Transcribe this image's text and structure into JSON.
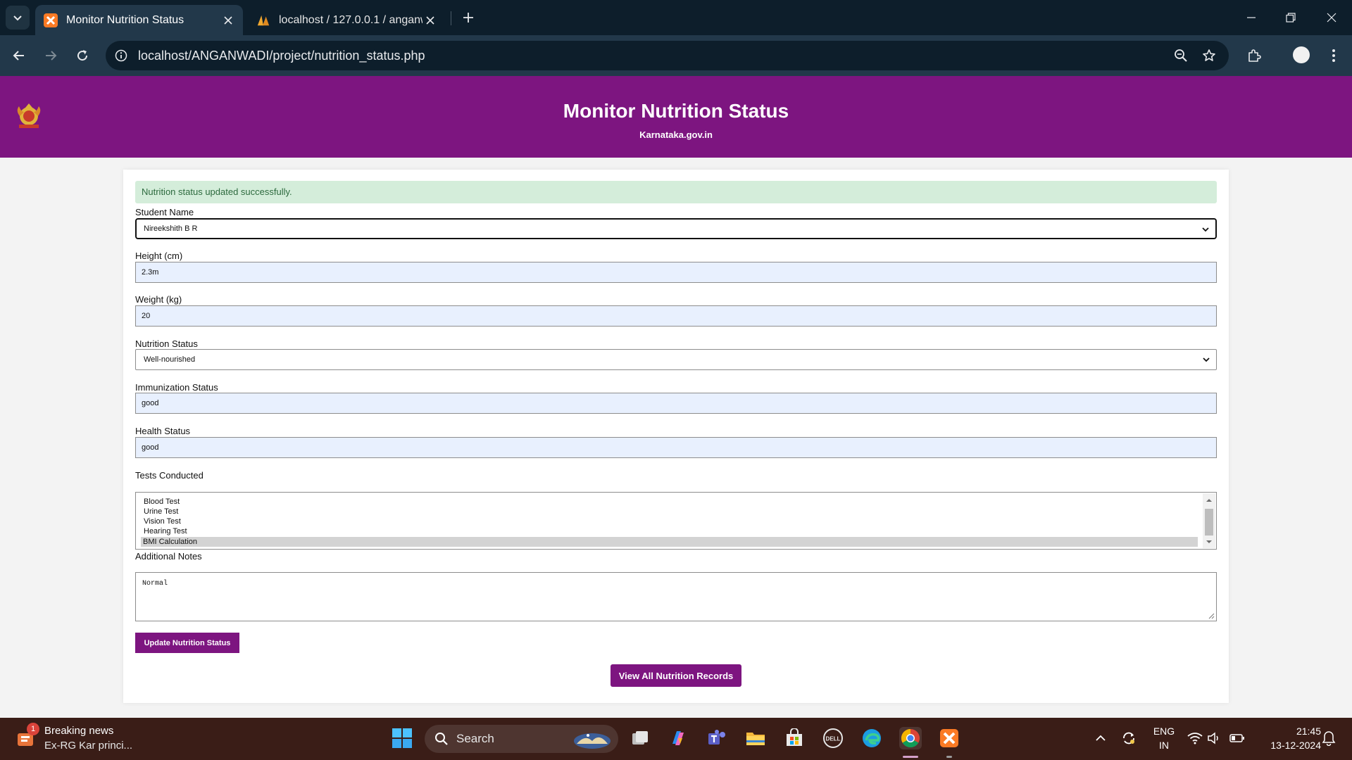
{
  "browser": {
    "tabs": [
      {
        "title": "Monitor Nutrition Status",
        "active": true,
        "favicon": "xampp-icon"
      },
      {
        "title": "localhost / 127.0.0.1 / anganwadi",
        "active": false,
        "favicon": "phpmyadmin-icon"
      }
    ],
    "url": "localhost/ANGANWADI/project/nutrition_status.php"
  },
  "header": {
    "title": "Monitor Nutrition Status",
    "subtitle": "Karnataka.gov.in"
  },
  "alert": {
    "message": "Nutrition status updated successfully.",
    "color": "#d4edda"
  },
  "form": {
    "student_name": {
      "label": "Student Name",
      "value": "Nireekshith B R"
    },
    "height": {
      "label": "Height (cm)",
      "value": "2.3m"
    },
    "weight": {
      "label": "Weight (kg)",
      "value": "20"
    },
    "nutrition_status": {
      "label": "Nutrition Status",
      "value": "Well-nourished"
    },
    "immunization_status": {
      "label": "Immunization Status",
      "value": "good"
    },
    "health_status": {
      "label": "Health Status",
      "value": "good"
    },
    "tests": {
      "label": "Tests Conducted",
      "options": [
        "Blood Test",
        "Urine Test",
        "Vision Test",
        "Hearing Test",
        "BMI Calculation"
      ],
      "selected": "BMI Calculation"
    },
    "notes": {
      "label": "Additional Notes",
      "value": "Normal"
    },
    "submit_label": "Update Nutrition Status"
  },
  "view_all_label": "View All Nutrition Records",
  "colors": {
    "brand": "#7d1580",
    "tabbar": "#0d1e2b",
    "toolbar": "#22384a",
    "taskbar": "#3a1d17"
  },
  "taskbar": {
    "news": {
      "badge": "1",
      "title": "Breaking news",
      "subtitle": "Ex-RG Kar princi..."
    },
    "search_placeholder": "Search",
    "language": {
      "line1": "ENG",
      "line2": "IN"
    },
    "time": "21:45",
    "date": "13-12-2024"
  }
}
